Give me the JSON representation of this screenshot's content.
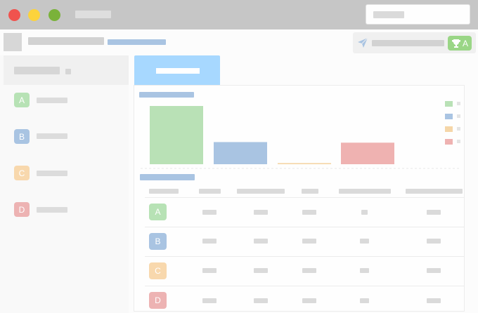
{
  "window": {
    "controls": [
      {
        "name": "close",
        "color": "#f0534e"
      },
      {
        "name": "minimize",
        "color": "#fcd33c"
      },
      {
        "name": "maximize",
        "color": "#7ab23a"
      }
    ],
    "title_bar_color": "#c6c6c6"
  },
  "toolbar": {
    "send_icon": "paper-plane-icon",
    "trophy_icon": "trophy-icon",
    "user_badge": "A",
    "badge_color": "#9ad686"
  },
  "sidebar": {
    "items": [
      {
        "badge": "A",
        "color": "#b7e2b5"
      },
      {
        "badge": "B",
        "color": "#a9c4e2"
      },
      {
        "badge": "C",
        "color": "#f8d8ad"
      },
      {
        "badge": "D",
        "color": "#edb3b3"
      }
    ]
  },
  "chart_data": {
    "type": "bar",
    "categories": [
      "",
      "",
      "",
      ""
    ],
    "series": [
      {
        "values": [
          1.0,
          0.38,
          0.02,
          0.37
        ]
      }
    ],
    "colors": [
      "#b9e1b6",
      "#a9c4e2",
      "#f5d6a8",
      "#efb2b1"
    ],
    "legend_position": "top-right",
    "grid": false
  },
  "table": {
    "rows": [
      {
        "badge": "A",
        "color": "#b7e2b5"
      },
      {
        "badge": "B",
        "color": "#a9c4e2"
      },
      {
        "badge": "C",
        "color": "#f8d8ad"
      },
      {
        "badge": "D",
        "color": "#edb3b3"
      }
    ]
  }
}
